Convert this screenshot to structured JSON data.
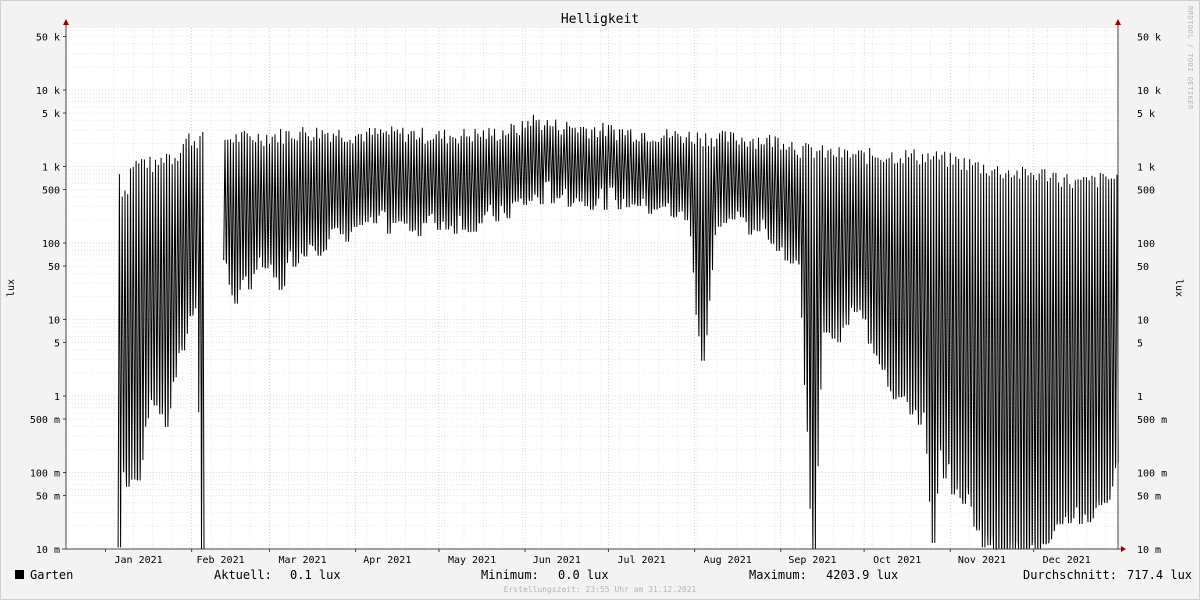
{
  "chart_data": {
    "type": "line",
    "title": "Helligkeit",
    "ylabel_left": "lux",
    "ylabel_right": "lux",
    "yscale": "log",
    "ylim": [
      10,
      80000
    ],
    "y_ticks": [
      {
        "value": 50000,
        "label": "50 k"
      },
      {
        "value": 10000,
        "label": "10 k"
      },
      {
        "value": 5000,
        "label": "5 k"
      },
      {
        "value": 1000,
        "label": "1 k"
      },
      {
        "value": 500,
        "label": "500"
      },
      {
        "value": 100,
        "label": "100"
      },
      {
        "value": 50,
        "label": "50"
      },
      {
        "value": 10,
        "label": "10"
      },
      {
        "value": 5,
        "label": "5"
      },
      {
        "value": 1,
        "label": "1"
      },
      {
        "value": 0.5,
        "label": "500 m"
      },
      {
        "value": 0.1,
        "label": "100 m"
      },
      {
        "value": 0.05,
        "label": "50 m"
      },
      {
        "value": 0.01,
        "label": "10 m"
      }
    ],
    "x_range": [
      "2021-01-01",
      "2021-12-31"
    ],
    "x_month_labels": [
      "Jan 2021",
      "Feb 2021",
      "Mar 2021",
      "Apr 2021",
      "May 2021",
      "Jun 2021",
      "Jul 2021",
      "Aug 2021",
      "Sep 2021",
      "Oct 2021",
      "Nov 2021",
      "Dec 2021"
    ],
    "series": [
      {
        "name": "Garten",
        "color": "#000000",
        "daily_max_lux": [
          [
            5,
            800
          ],
          [
            6,
            500
          ],
          [
            7,
            500
          ],
          [
            8,
            550
          ],
          [
            9,
            900
          ],
          [
            10,
            1100
          ],
          [
            12,
            1100
          ],
          [
            14,
            1200
          ],
          [
            16,
            1100
          ],
          [
            18,
            1000
          ],
          [
            20,
            1200
          ],
          [
            22,
            1500
          ],
          [
            24,
            1300
          ],
          [
            26,
            1500
          ],
          [
            28,
            2000
          ],
          [
            30,
            2400
          ],
          [
            32,
            2200
          ],
          [
            34,
            2300
          ],
          [
            35,
            2300
          ],
          [
            43,
            2300
          ],
          [
            50,
            2400
          ],
          [
            60,
            2500
          ],
          [
            70,
            2800
          ],
          [
            80,
            2800
          ],
          [
            90,
            2600
          ],
          [
            100,
            2700
          ],
          [
            110,
            2700
          ],
          [
            120,
            2500
          ],
          [
            130,
            2600
          ],
          [
            140,
            2700
          ],
          [
            150,
            3200
          ],
          [
            153,
            4200
          ],
          [
            160,
            3500
          ],
          [
            170,
            3200
          ],
          [
            180,
            3000
          ],
          [
            190,
            2800
          ],
          [
            200,
            2600
          ],
          [
            210,
            2500
          ],
          [
            220,
            2400
          ],
          [
            230,
            2300
          ],
          [
            240,
            2200
          ],
          [
            245,
            2200
          ],
          [
            250,
            1700
          ],
          [
            260,
            1500
          ],
          [
            270,
            1400
          ],
          [
            280,
            1400
          ],
          [
            290,
            1400
          ],
          [
            300,
            1300
          ],
          [
            305,
            1200
          ],
          [
            310,
            1100
          ],
          [
            320,
            900
          ],
          [
            330,
            800
          ],
          [
            340,
            800
          ],
          [
            350,
            600
          ],
          [
            360,
            700
          ],
          [
            364,
            700
          ]
        ],
        "daily_min_lux": [
          [
            5,
            0.01
          ],
          [
            6,
            0.2
          ],
          [
            8,
            0.05
          ],
          [
            10,
            0.15
          ],
          [
            12,
            0.1
          ],
          [
            15,
            0.8
          ],
          [
            18,
            1
          ],
          [
            20,
            0.7
          ],
          [
            22,
            0.5
          ],
          [
            25,
            2
          ],
          [
            28,
            5
          ],
          [
            30,
            10
          ],
          [
            33,
            30
          ],
          [
            35,
            0.01
          ],
          [
            43,
            60
          ],
          [
            45,
            30
          ],
          [
            48,
            20
          ],
          [
            52,
            40
          ],
          [
            56,
            60
          ],
          [
            60,
            40
          ],
          [
            63,
            30
          ],
          [
            66,
            60
          ],
          [
            70,
            100
          ],
          [
            80,
            120
          ],
          [
            90,
            180
          ],
          [
            100,
            200
          ],
          [
            110,
            200
          ],
          [
            120,
            200
          ],
          [
            130,
            220
          ],
          [
            140,
            240
          ],
          [
            150,
            350
          ],
          [
            160,
            500
          ],
          [
            170,
            450
          ],
          [
            180,
            450
          ],
          [
            190,
            400
          ],
          [
            200,
            300
          ],
          [
            210,
            250
          ],
          [
            215,
            3
          ],
          [
            220,
            250
          ],
          [
            230,
            200
          ],
          [
            240,
            160
          ],
          [
            248,
            70
          ],
          [
            250,
            50
          ],
          [
            255,
            0.01
          ],
          [
            258,
            10
          ],
          [
            262,
            7
          ],
          [
            266,
            10
          ],
          [
            270,
            15
          ],
          [
            275,
            7
          ],
          [
            280,
            3
          ],
          [
            285,
            1
          ],
          [
            290,
            0.8
          ],
          [
            295,
            0.5
          ],
          [
            298,
            0.01
          ],
          [
            300,
            0.2
          ],
          [
            305,
            0.08
          ],
          [
            310,
            0.05
          ],
          [
            315,
            0.02
          ],
          [
            320,
            0.01
          ],
          [
            325,
            0.01
          ],
          [
            330,
            0.01
          ],
          [
            335,
            0.01
          ],
          [
            340,
            0.01
          ],
          [
            345,
            0.03
          ],
          [
            350,
            0.03
          ],
          [
            355,
            0.03
          ],
          [
            360,
            0.05
          ],
          [
            364,
            0.1
          ]
        ]
      }
    ],
    "gap_days": [
      [
        36,
        42
      ]
    ],
    "grid": true
  },
  "legend": {
    "series_name": "Garten",
    "series_color": "#000000"
  },
  "stats": {
    "current_label": "Aktuell:",
    "current_value": "0.1 lux",
    "min_label": "Minimum:",
    "min_value": "0.0 lux",
    "max_label": "Maximum:",
    "max_value": "4203.9 lux",
    "avg_label": "Durchschnitt:",
    "avg_value": "717.4 lux"
  },
  "watermark": "RRDTOOL / TOBI OETIKER",
  "footer_note": "Erstellungszeit: 23:55 Uhr am 31.12.2021",
  "colors": {
    "background": "#f3f3f3",
    "canvas": "#ffffff",
    "major_grid": "#e9a8a8",
    "minor_grid": "#cfcfcf",
    "arrow": "#a00000"
  }
}
